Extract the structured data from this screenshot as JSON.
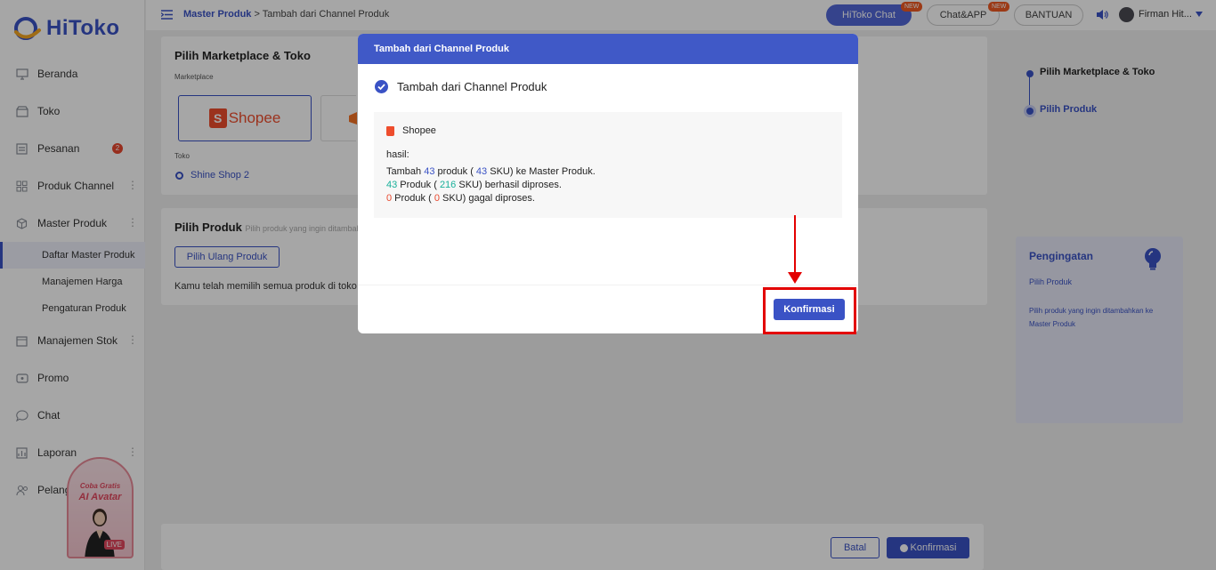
{
  "app": {
    "logo_text": "HiToko"
  },
  "sidebar": {
    "items": [
      {
        "label": "Beranda",
        "icon": "monitor-icon"
      },
      {
        "label": "Toko",
        "icon": "store-icon"
      },
      {
        "label": "Pesanan",
        "icon": "orders-icon",
        "badge": "2"
      },
      {
        "label": "Produk Channel",
        "icon": "grid-icon"
      },
      {
        "label": "Master Produk",
        "icon": "cube-icon"
      }
    ],
    "sub_items": [
      "Daftar Master Produk",
      "Manajemen Harga",
      "Pengaturan Produk"
    ],
    "items_after": [
      {
        "label": "Manajemen Stok",
        "icon": "box-icon"
      },
      {
        "label": "Promo",
        "icon": "tag-icon"
      },
      {
        "label": "Chat",
        "icon": "chat-icon"
      },
      {
        "label": "Laporan",
        "icon": "report-icon"
      },
      {
        "label": "Pelanggan",
        "icon": "people-icon"
      }
    ],
    "promo": {
      "line1": "Coba Gratis",
      "line2": "AI Avatar",
      "live": "LIVE"
    }
  },
  "header": {
    "breadcrumb_link": "Master Produk",
    "breadcrumb_sep": " > ",
    "breadcrumb_current": "Tambah dari Channel Produk",
    "hitoko_chat": "HiToko Chat",
    "chat_app": "Chat&APP",
    "new_tag": "NEW",
    "help": "BANTUAN",
    "username": "Firman Hit..."
  },
  "page": {
    "card1": {
      "title": "Pilih Marketplace & Toko",
      "marketplace_label": "Marketplace",
      "marketplace_name": "Shopee",
      "toko_label": "Toko",
      "shop_name": "Shine Shop 2"
    },
    "card2": {
      "title": "Pilih Produk",
      "subtitle": "Pilih produk yang ingin ditambahkan",
      "reselect_button": "Pilih Ulang Produk",
      "info": "Kamu telah memilih semua produk di toko ini"
    },
    "steps": [
      "Pilih Marketplace & Toko",
      "Pilih Produk"
    ],
    "reminder": {
      "title": "Pengingatan",
      "subtitle": "Pilih Produk",
      "body": "Pilih produk yang ingin ditambahkan ke Master Produk"
    },
    "footer": {
      "cancel": "Batal",
      "confirm": "Konfirmasi"
    }
  },
  "modal": {
    "title": "Tambah dari Channel Produk",
    "success_text": "Tambah dari Channel Produk",
    "shop": "Shopee",
    "hasil_label": "hasil:",
    "line1": {
      "a": "Tambah ",
      "n1": "43",
      "b": " produk ( ",
      "n2": "43",
      "c": " SKU) ke Master Produk."
    },
    "line2": {
      "n1": "43",
      "a": " Produk ( ",
      "n2": "216",
      "b": " SKU) berhasil diproses."
    },
    "line3": {
      "n1": "0",
      "a": " Produk ( ",
      "n2": "0",
      "b": " SKU) gagal diproses."
    },
    "confirm_button": "Konfirmasi"
  },
  "colors": {
    "brand": "#3a52c5",
    "modal_header": "#4059c7",
    "annotation_red": "#e30000",
    "success_green": "#19b09a",
    "fail_red": "#e8482e"
  }
}
